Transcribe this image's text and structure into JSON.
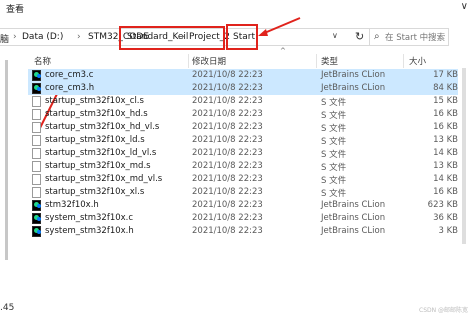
{
  "menu": {
    "view": "查看"
  },
  "window": {
    "collapse": "∨"
  },
  "breadcrumb": {
    "partial": "脑",
    "items": [
      "Data (D:)",
      "STM32_CODE",
      "Standard_Keil",
      "Project_2",
      "Start"
    ]
  },
  "search": {
    "placeholder": "在 Start 中搜索"
  },
  "columns": {
    "name": "名称",
    "date": "修改日期",
    "type": "类型",
    "size": "大小"
  },
  "files": [
    {
      "name": "core_cm3.c",
      "date": "2021/10/8 22:23",
      "type": "JetBrains CLion",
      "size": "17 KB",
      "icon": "clion",
      "selected": true
    },
    {
      "name": "core_cm3.h",
      "date": "2021/10/8 22:23",
      "type": "JetBrains CLion",
      "size": "84 KB",
      "icon": "clion",
      "selected": true
    },
    {
      "name": "startup_stm32f10x_cl.s",
      "date": "2021/10/8 22:23",
      "type": "S 文件",
      "size": "15 KB",
      "icon": "doc",
      "selected": false
    },
    {
      "name": "startup_stm32f10x_hd.s",
      "date": "2021/10/8 22:23",
      "type": "S 文件",
      "size": "16 KB",
      "icon": "doc",
      "selected": false
    },
    {
      "name": "startup_stm32f10x_hd_vl.s",
      "date": "2021/10/8 22:23",
      "type": "S 文件",
      "size": "16 KB",
      "icon": "doc",
      "selected": false
    },
    {
      "name": "startup_stm32f10x_ld.s",
      "date": "2021/10/8 22:23",
      "type": "S 文件",
      "size": "13 KB",
      "icon": "doc",
      "selected": false
    },
    {
      "name": "startup_stm32f10x_ld_vl.s",
      "date": "2021/10/8 22:23",
      "type": "S 文件",
      "size": "14 KB",
      "icon": "doc",
      "selected": false
    },
    {
      "name": "startup_stm32f10x_md.s",
      "date": "2021/10/8 22:23",
      "type": "S 文件",
      "size": "13 KB",
      "icon": "doc",
      "selected": false
    },
    {
      "name": "startup_stm32f10x_md_vl.s",
      "date": "2021/10/8 22:23",
      "type": "S 文件",
      "size": "14 KB",
      "icon": "doc",
      "selected": false
    },
    {
      "name": "startup_stm32f10x_xl.s",
      "date": "2021/10/8 22:23",
      "type": "S 文件",
      "size": "16 KB",
      "icon": "doc",
      "selected": false
    },
    {
      "name": "stm32f10x.h",
      "date": "2021/10/8 22:23",
      "type": "JetBrains CLion",
      "size": "623 KB",
      "icon": "clion",
      "selected": false
    },
    {
      "name": "system_stm32f10x.c",
      "date": "2021/10/8 22:23",
      "type": "JetBrains CLion",
      "size": "36 KB",
      "icon": "clion",
      "selected": false
    },
    {
      "name": "system_stm32f10x.h",
      "date": "2021/10/8 22:23",
      "type": "JetBrains CLion",
      "size": "3 KB",
      "icon": "clion",
      "selected": false
    }
  ],
  "left_number": "45",
  "watermark": "CSDN @邮邮陈宽",
  "colors": {
    "selection": "#cce8ff",
    "annotation_red": "#e0231c"
  }
}
